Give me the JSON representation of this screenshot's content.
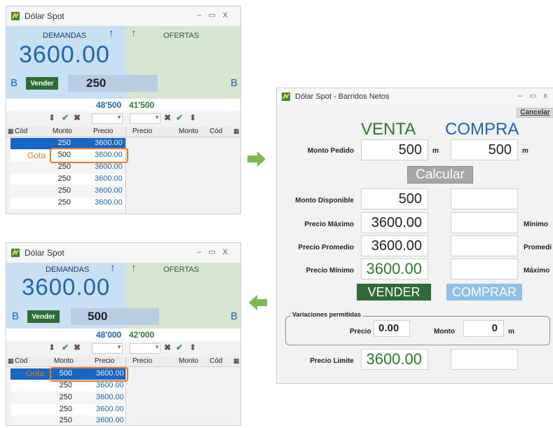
{
  "win1": {
    "title": "Dólar Spot",
    "demandas_label": "DEMANDAS",
    "ofertas_label": "OFERTAS",
    "price": "3600.00",
    "b_left": "B",
    "b_right": "B",
    "vender_label": "Vender",
    "qty": "250",
    "total_demand": "48'500",
    "total_offer": "41'500",
    "headers": [
      "Cód",
      "Monto",
      "Precio",
      "Precio",
      "Monto",
      "Cód"
    ],
    "gota_label": "Gota",
    "rows": [
      {
        "monto": "250",
        "precio": "3600.00"
      },
      {
        "monto": "500",
        "precio": "3600.00"
      },
      {
        "monto": "250",
        "precio": "3600.00"
      },
      {
        "monto": "250",
        "precio": "3600.00"
      },
      {
        "monto": "250",
        "precio": "3600.00"
      },
      {
        "monto": "250",
        "precio": "3600.00"
      }
    ]
  },
  "win2": {
    "title": "Dólar Spot",
    "demandas_label": "DEMANDAS",
    "ofertas_label": "OFERTAS",
    "price": "3600.00",
    "b_left": "B",
    "b_right": "B",
    "vender_label": "Vender",
    "qty": "500",
    "total_demand": "48'000",
    "total_offer": "42'000",
    "headers": [
      "Cód",
      "Monto",
      "Precio",
      "Precio",
      "Monto",
      "Cód"
    ],
    "gota_label": "Gota",
    "rows": [
      {
        "monto": "500",
        "precio": "3600.00"
      },
      {
        "monto": "250",
        "precio": "3600.00"
      },
      {
        "monto": "250",
        "precio": "3600.00"
      },
      {
        "monto": "250",
        "precio": "3600.00"
      },
      {
        "monto": "250",
        "precio": "3600.00"
      }
    ]
  },
  "barridos": {
    "title": "Dólar Spot - Barridos Netos",
    "cancelar": "Cancelar",
    "venta": "VENTA",
    "compra": "COMPRA",
    "monto_pedido_label": "Monto Pedido",
    "monto_pedido_venta": "500",
    "monto_pedido_compra": "500",
    "unit_m": "m",
    "calcular": "Calcular",
    "monto_disponible_label": "Monto Disponible",
    "monto_disponible": "500",
    "precio_maximo_label": "Precio Máximo",
    "precio_maximo": "3600.00",
    "minimo_label": "Mínimo",
    "precio_promedio_label": "Precio Promedio",
    "precio_promedio": "3600.00",
    "promedio_label": "Promedi",
    "precio_minimo_label": "Precio Mínimo",
    "precio_minimo": "3600.00",
    "maximo_label": "Máximo",
    "vender": "VENDER",
    "comprar": "COMPRAR",
    "variaciones_label": "Variaciones permitidas",
    "precio_label": "Precio",
    "precio_var": "0.00",
    "monto_label": "Monto",
    "monto_var": "0",
    "precio_limite_label": "Precio Limite",
    "precio_limite": "3600.00"
  },
  "colors": {
    "accent_blue": "#1c66b2",
    "accent_green": "#2f7a2f",
    "highlight_orange": "#e8782a",
    "demand_bg": "#c9dff3",
    "offer_bg": "#d7e6d0"
  }
}
